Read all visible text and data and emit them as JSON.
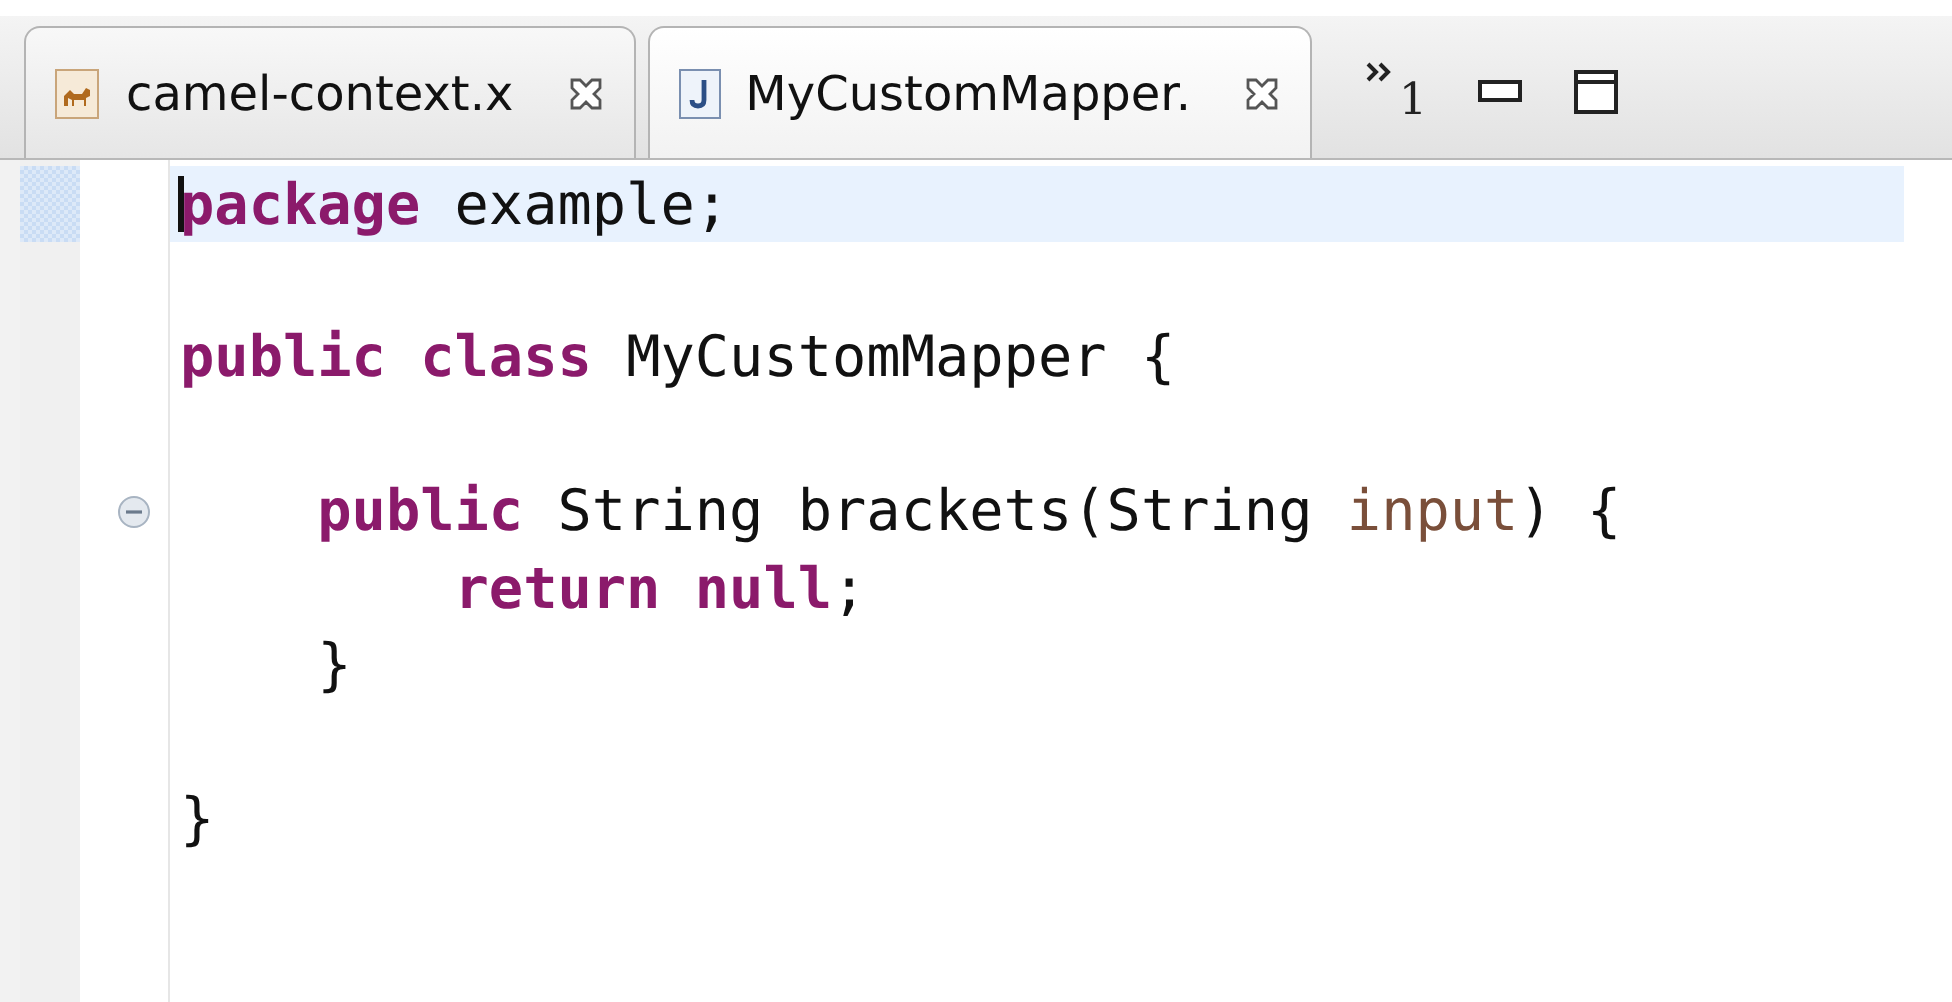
{
  "tabs": [
    {
      "label": "camel-context.x",
      "kind": "xml",
      "selected": false
    },
    {
      "label": "MyCustomMapper.",
      "kind": "java",
      "selected": true
    }
  ],
  "overflow_count": "1",
  "lines": [
    {
      "current": true,
      "collapsible": false,
      "tokens": [
        {
          "kind": "keyword",
          "text": "package"
        },
        {
          "kind": "plain",
          "text": " example;"
        }
      ]
    },
    {
      "current": false,
      "collapsible": false
    },
    {
      "current": false,
      "collapsible": false,
      "tokens": [
        {
          "kind": "keyword",
          "text": "public"
        },
        {
          "kind": "keyword",
          "text": " class"
        },
        {
          "kind": "plain",
          "text": " MyCustomMapper {"
        }
      ]
    },
    {
      "current": false,
      "collapsible": false
    },
    {
      "current": false,
      "collapsible": true,
      "tokens": [
        {
          "kind": "keyword",
          "text": "    public"
        },
        {
          "kind": "plain",
          "text": " String brackets(String"
        },
        {
          "kind": "param",
          "text": " input"
        },
        {
          "kind": "plain",
          "text": ") {"
        }
      ]
    },
    {
      "current": false,
      "collapsible": false,
      "tokens": [
        {
          "kind": "keyword",
          "text": "        return"
        },
        {
          "kind": "keyword",
          "text": " null"
        },
        {
          "kind": "plain",
          "text": ";"
        }
      ]
    },
    {
      "current": false,
      "collapsible": false,
      "tokens": [
        {
          "kind": "plain",
          "text": "    }"
        }
      ]
    },
    {
      "current": false,
      "collapsible": false
    },
    {
      "current": false,
      "collapsible": false,
      "tokens": [
        {
          "kind": "plain",
          "text": "}"
        }
      ]
    },
    {
      "current": false,
      "collapsible": false
    },
    {
      "current": false,
      "collapsible": false
    }
  ]
}
